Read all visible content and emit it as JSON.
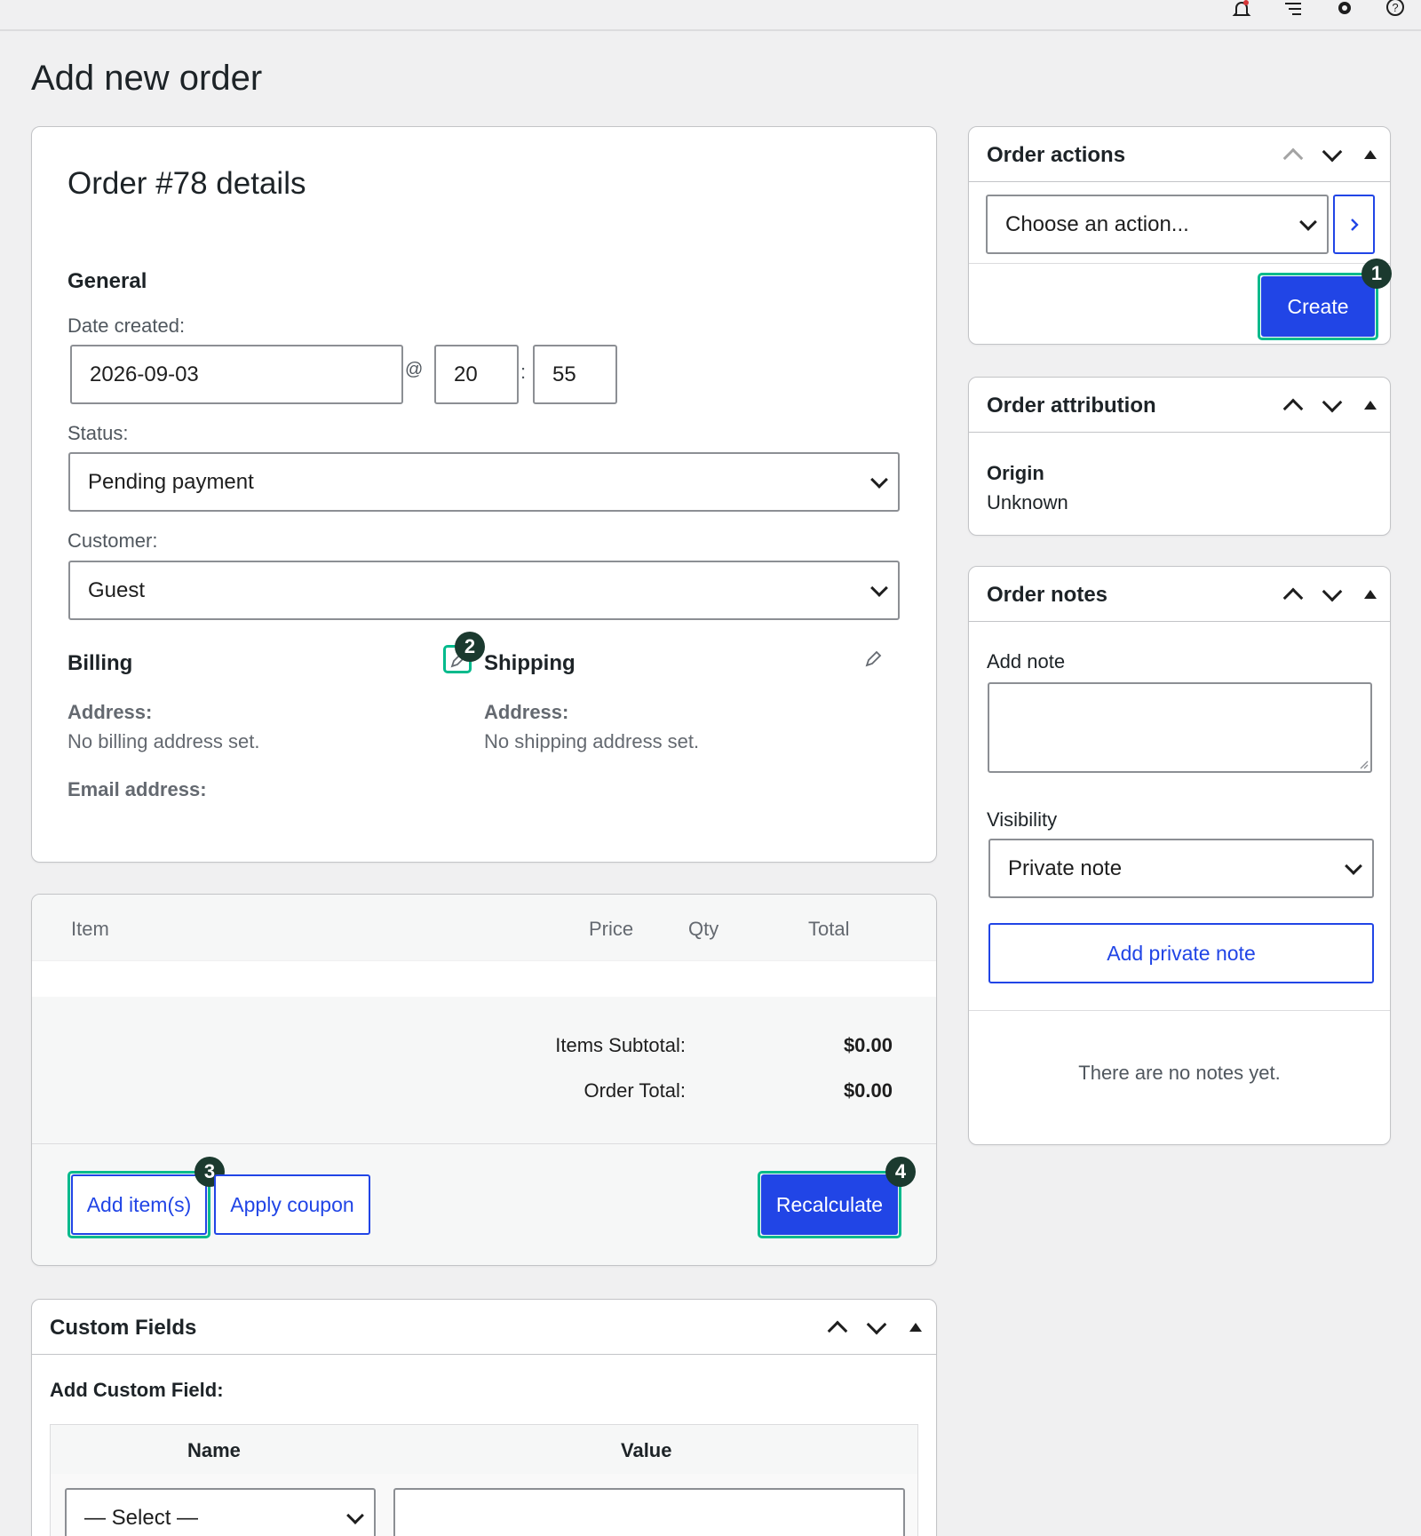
{
  "topbar": {
    "icons": [
      "bell-icon",
      "list-icon",
      "gear-icon",
      "help-icon"
    ]
  },
  "page": {
    "title": "Add new order"
  },
  "order_details": {
    "heading": "Order #78 details",
    "general_heading": "General",
    "date_label": "Date created:",
    "date_value": "2026-09-03",
    "at_sep": "@",
    "hour_value": "20",
    "colon_sep": ":",
    "minute_value": "55",
    "status_label": "Status:",
    "status_value": "Pending payment",
    "customer_label": "Customer:",
    "customer_value": "Guest",
    "billing_heading": "Billing",
    "billing_address_label": "Address:",
    "billing_address_value": "No billing address set.",
    "email_label": "Email address:",
    "shipping_heading": "Shipping",
    "shipping_address_label": "Address:",
    "shipping_address_value": "No shipping address set."
  },
  "items": {
    "columns": [
      "Item",
      "Price",
      "Qty",
      "Total"
    ],
    "subtotal_label": "Items Subtotal:",
    "subtotal_value": "$0.00",
    "total_label": "Order Total:",
    "total_value": "$0.00",
    "add_items_label": "Add item(s)",
    "apply_coupon_label": "Apply coupon",
    "recalculate_label": "Recalculate"
  },
  "custom_fields": {
    "title": "Custom Fields",
    "add_label": "Add Custom Field:",
    "name_col": "Name",
    "value_col": "Value",
    "select_value": "— Select —"
  },
  "order_actions": {
    "title": "Order actions",
    "select_value": "Choose an action...",
    "create_label": "Create"
  },
  "order_attribution": {
    "title": "Order attribution",
    "origin_label": "Origin",
    "origin_value": "Unknown"
  },
  "order_notes": {
    "title": "Order notes",
    "add_note_label": "Add note",
    "visibility_label": "Visibility",
    "visibility_value": "Private note",
    "add_button": "Add private note",
    "empty_text": "There are no notes yet."
  },
  "badges": [
    "1",
    "2",
    "3",
    "4"
  ],
  "colors": {
    "accent": "#2145e6",
    "focus": "#00ba8c",
    "badge": "#1b3a2f",
    "background": "#f0f0f1"
  }
}
